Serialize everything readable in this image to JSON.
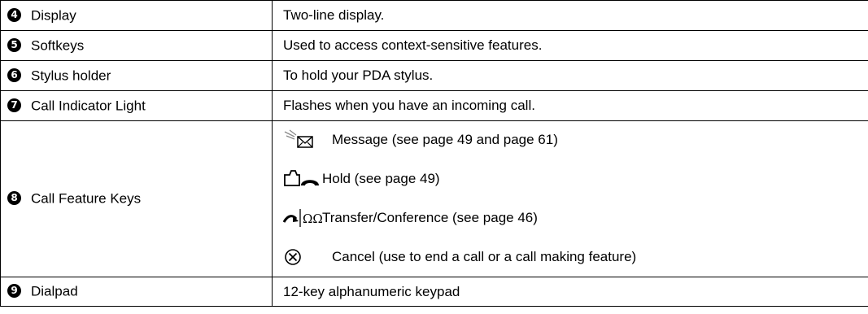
{
  "rows": [
    {
      "number": "4",
      "name": "Display",
      "description": "Two-line display."
    },
    {
      "number": "5",
      "name": "Softkeys",
      "description": "Used to access context-sensitive features."
    },
    {
      "number": "6",
      "name": "Stylus holder",
      "description": "To hold your PDA stylus."
    },
    {
      "number": "7",
      "name": "Call Indicator Light",
      "description": "Flashes when you have an incoming call."
    },
    {
      "number": "8",
      "name": "Call Feature Keys",
      "items": [
        {
          "icon": "message-envelope-icon",
          "text": "Message (see page 49 and page 61)"
        },
        {
          "icon": "hold-handset-icon",
          "text": "Hold (see page 49)"
        },
        {
          "icon": "transfer-conference-icon",
          "text": "Transfer/Conference (see page 46)"
        },
        {
          "icon": "cancel-x-icon",
          "text": "Cancel (use to end a call or a call making feature)"
        }
      ]
    },
    {
      "number": "9",
      "name": "Dialpad",
      "description": "12-key alphanumeric keypad"
    }
  ]
}
